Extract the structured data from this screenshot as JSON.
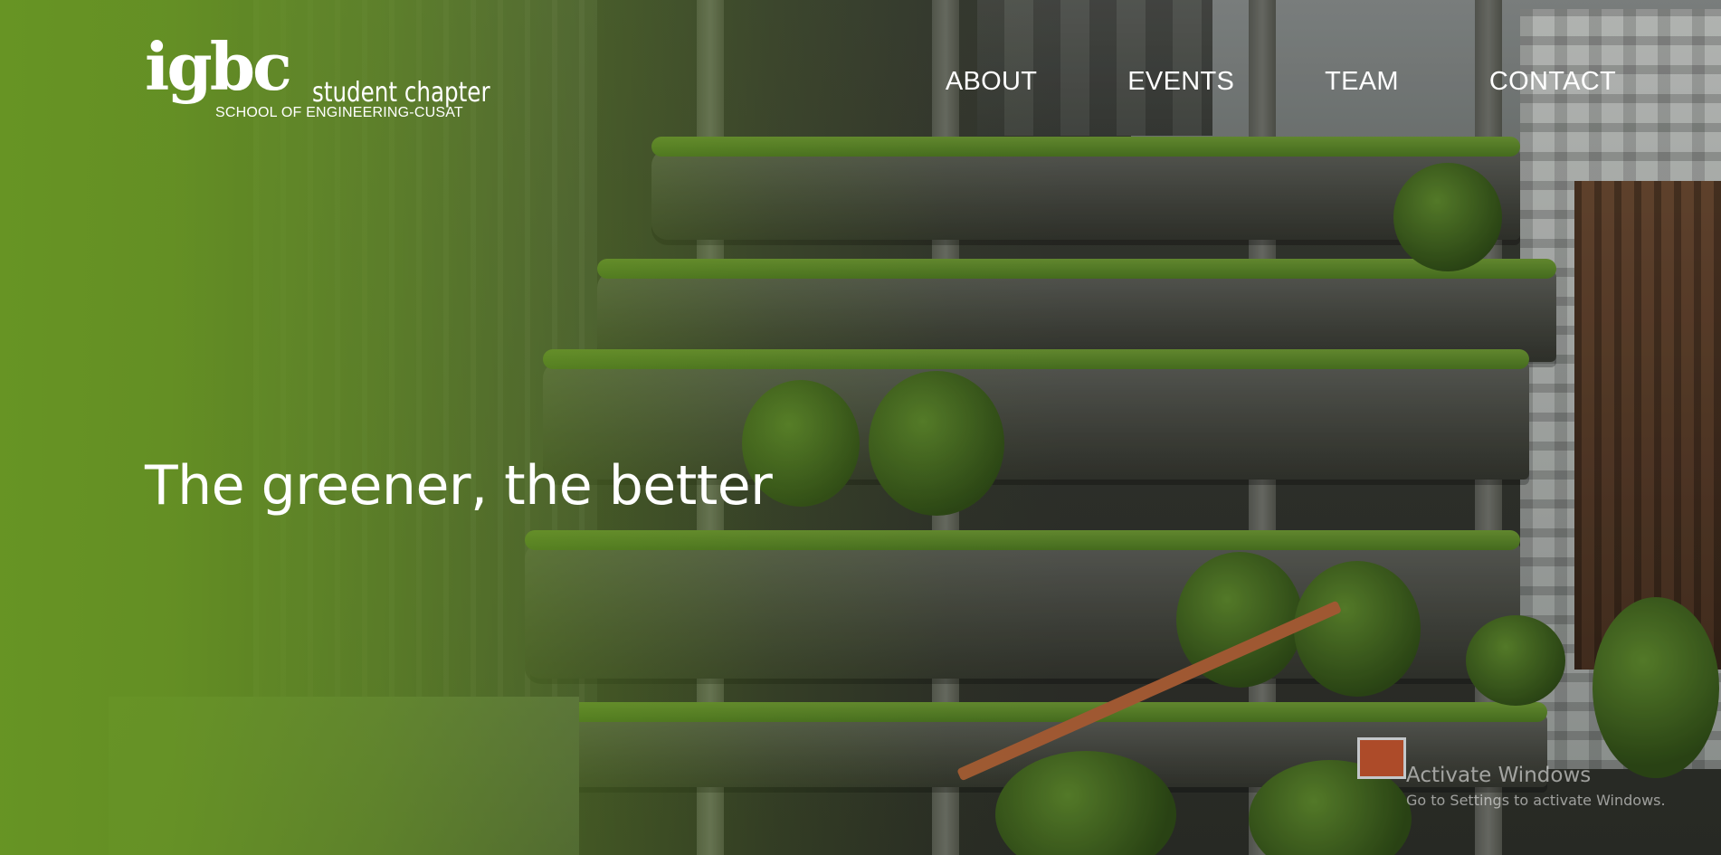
{
  "brand": {
    "logo_mark": "igbc",
    "chapter": "student chapter",
    "school": "SCHOOL OF ENGINEERING-CUSAT"
  },
  "nav": {
    "items": [
      {
        "label": "ABOUT"
      },
      {
        "label": "EVENTS"
      },
      {
        "label": "TEAM"
      },
      {
        "label": "CONTACT"
      }
    ]
  },
  "hero": {
    "title": "The greener, the better"
  },
  "watermark": {
    "title": "Activate Windows",
    "subtitle": "Go to Settings to activate Windows."
  },
  "colors": {
    "overlay_green": "#68962a",
    "text": "#ffffff"
  }
}
